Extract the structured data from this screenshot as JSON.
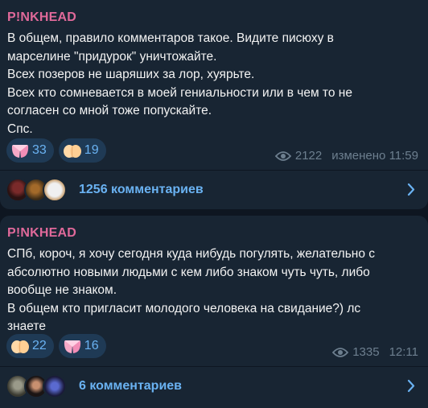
{
  "posts": [
    {
      "author": "P!NKHEAD",
      "text": "В общем, правило комментаров такое. Видите писюху в\nмарселине \"придурок\" уничтожайте.\nВсех позеров не шаряших за лор, хуярьте.\nВсех кто сомневается в моей гениальности или в чем то не\nсогласен со мной тоже попускайте.\nСпс.",
      "reactions": [
        {
          "icon": "pink-butt-emoji",
          "count": "33"
        },
        {
          "icon": "peach-butt-emoji",
          "count": "19"
        }
      ],
      "views": "2122",
      "time": "изменено 11:59",
      "comments_label": "1256 комментариев"
    },
    {
      "author": "P!NKHEAD",
      "text": "СПб, короч, я хочу сегодня куда нибудь погулять, желательно с\nабсолютно новыми людьми с кем либо знаком чуть чуть, либо\nвообще не знаком.\nВ общем кто пригласит молодого человека на свидание?) лс\nзнаете",
      "reactions": [
        {
          "icon": "peach-butt-emoji",
          "count": "22"
        },
        {
          "icon": "pink-butt-emoji",
          "count": "16"
        }
      ],
      "views": "1335",
      "time": "12:11",
      "comments_label": "6 комментариев"
    }
  ],
  "colors": {
    "background": "#0e1621",
    "bubble": "#182533",
    "author": "#e0699a",
    "accent": "#6ab2f2",
    "meta": "#6d7f8f"
  }
}
